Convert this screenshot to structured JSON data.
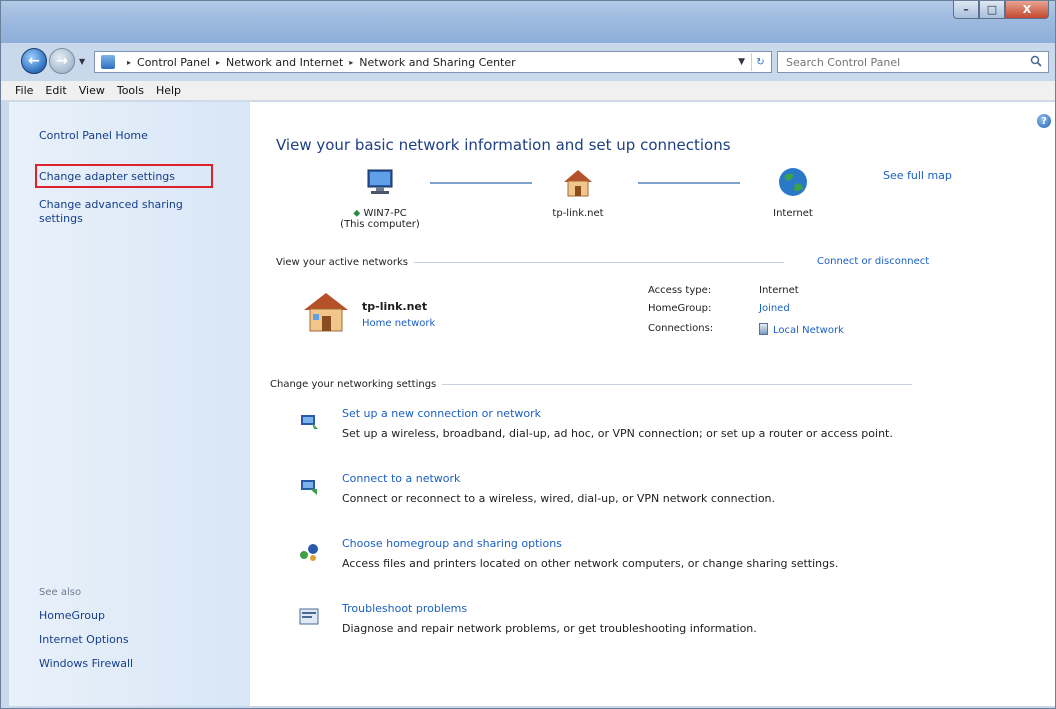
{
  "window": {
    "caption_min": "–",
    "caption_max": "□",
    "caption_close": "X"
  },
  "nav": {
    "back_glyph": "←",
    "forward_glyph": "→",
    "breadcrumb": [
      "Control Panel",
      "Network and Internet",
      "Network and Sharing Center"
    ],
    "breadcrumb_separator": "▸",
    "search_placeholder": "Search Control Panel"
  },
  "menubar": {
    "items": [
      "File",
      "Edit",
      "View",
      "Tools",
      "Help"
    ]
  },
  "sidebar": {
    "home": "Control Panel Home",
    "change_adapter": "Change adapter settings",
    "change_advanced": "Change advanced sharing settings",
    "see_also_heading": "See also",
    "see_also": [
      "HomeGroup",
      "Internet Options",
      "Windows Firewall"
    ]
  },
  "main": {
    "help_glyph": "?",
    "heading": "View your basic network information and set up connections",
    "see_full_map": "See full map",
    "map": {
      "computer_name": "WIN7-PC",
      "computer_sub": "(This computer)",
      "router_name": "tp-link.net",
      "internet_name": "Internet"
    },
    "active_networks_heading": "View your active networks",
    "connect_or_disconnect": "Connect or disconnect",
    "network": {
      "name": "tp-link.net",
      "type": "Home network",
      "access_type_label": "Access type:",
      "access_type_value": "Internet",
      "homegroup_label": "HomeGroup:",
      "homegroup_value": "Joined",
      "connections_label": "Connections:",
      "connections_value": "Local Network"
    },
    "change_settings_heading": "Change your networking settings",
    "tasks": [
      {
        "title": "Set up a new connection or network",
        "desc": "Set up a wireless, broadband, dial-up, ad hoc, or VPN connection; or set up a router or access point."
      },
      {
        "title": "Connect to a network",
        "desc": "Connect or reconnect to a wireless, wired, dial-up, or VPN network connection."
      },
      {
        "title": "Choose homegroup and sharing options",
        "desc": "Access files and printers located on other network computers, or change sharing settings."
      },
      {
        "title": "Troubleshoot problems",
        "desc": "Diagnose and repair network problems, or get troubleshooting information."
      }
    ]
  }
}
